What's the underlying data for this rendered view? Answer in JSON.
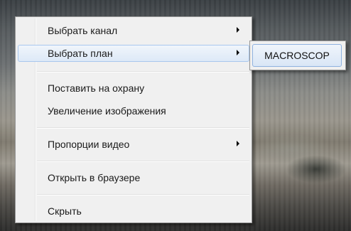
{
  "context_menu": {
    "items": [
      {
        "label": "Выбрать канал",
        "submenu": true
      },
      {
        "label": "Выбрать план",
        "submenu": true,
        "highlighted": true
      },
      {
        "label": "Поставить на охрану",
        "submenu": false
      },
      {
        "label": "Увеличение изображения",
        "submenu": false
      },
      {
        "label": "Пропорции видео",
        "submenu": true
      },
      {
        "label": "Открыть в браузере",
        "submenu": false
      },
      {
        "label": "Скрыть",
        "submenu": false
      }
    ]
  },
  "submenu": {
    "items": [
      {
        "label": "MACROSCOP"
      }
    ]
  },
  "colors": {
    "menu_background": "#f0f0f0",
    "highlight_border": "#a9c7ee",
    "highlight_fill": "#dde9f7"
  },
  "icons": {
    "submenu_arrow": "chevron-right-icon"
  }
}
